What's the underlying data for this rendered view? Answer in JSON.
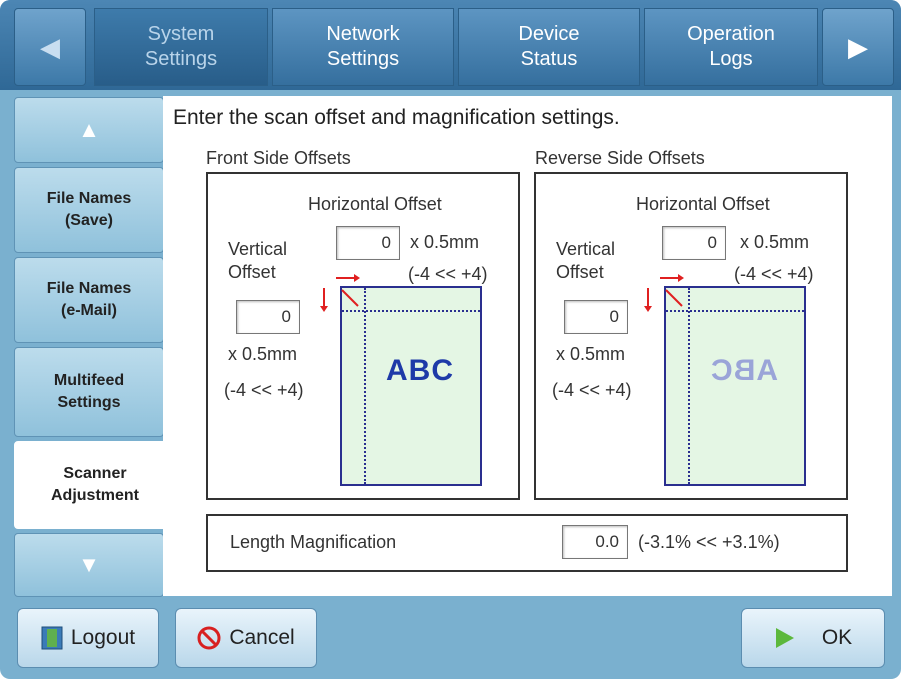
{
  "top_tabs": [
    {
      "label": "System\nSettings"
    },
    {
      "label": "Network\nSettings"
    },
    {
      "label": "Device\nStatus"
    },
    {
      "label": "Operation\nLogs"
    }
  ],
  "sidebar": {
    "items": [
      {
        "label": "File Names\n(Save)"
      },
      {
        "label": "File Names\n(e-Mail)"
      },
      {
        "label": "Multifeed\nSettings"
      },
      {
        "label": "Scanner\nAdjustment"
      }
    ]
  },
  "instruction": "Enter the scan offset and magnification settings.",
  "front": {
    "title": "Front Side Offsets",
    "horizontal_label": "Horizontal Offset",
    "horizontal_value": "0",
    "horizontal_unit": "x 0.5mm",
    "horizontal_range": "(-4 << +4)",
    "vertical_label": "Vertical\nOffset",
    "vertical_value": "0",
    "vertical_unit": "x 0.5mm",
    "vertical_range": "(-4 << +4)",
    "sample_text": "ABC"
  },
  "reverse": {
    "title": "Reverse Side Offsets",
    "horizontal_label": "Horizontal Offset",
    "horizontal_value": "0",
    "horizontal_unit": "x 0.5mm",
    "horizontal_range": "(-4 << +4)",
    "vertical_label": "Vertical\nOffset",
    "vertical_value": "0",
    "vertical_unit": "x 0.5mm",
    "vertical_range": "(-4 << +4)",
    "sample_text": "ABC"
  },
  "magnification": {
    "label": "Length Magnification",
    "value": "0.0",
    "range": "(-3.1% << +3.1%)"
  },
  "buttons": {
    "logout": "Logout",
    "cancel": "Cancel",
    "ok": "OK"
  },
  "colors": {
    "tab_bar": "#2f6896",
    "background": "#7ab0cf",
    "paper": "#e4f6e4",
    "arrow_red": "#e02020"
  }
}
